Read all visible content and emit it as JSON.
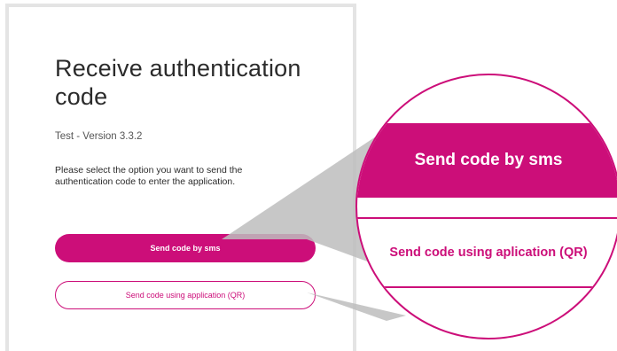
{
  "auth": {
    "title": "Receive authentication code",
    "version": "Test - Version 3.3.2",
    "instructions": "Please select the option you want to send the authentication code to enter the application.",
    "sms_button": "Send code by sms",
    "qr_button": "Send code using application (QR)"
  },
  "zoom": {
    "sms_button": "Send code by sms",
    "qr_button": "Send code using aplication (QR)"
  },
  "colors": {
    "accent": "#cc0e79",
    "card_border": "#e4e4e4",
    "shadow": "#bdbdbd"
  }
}
